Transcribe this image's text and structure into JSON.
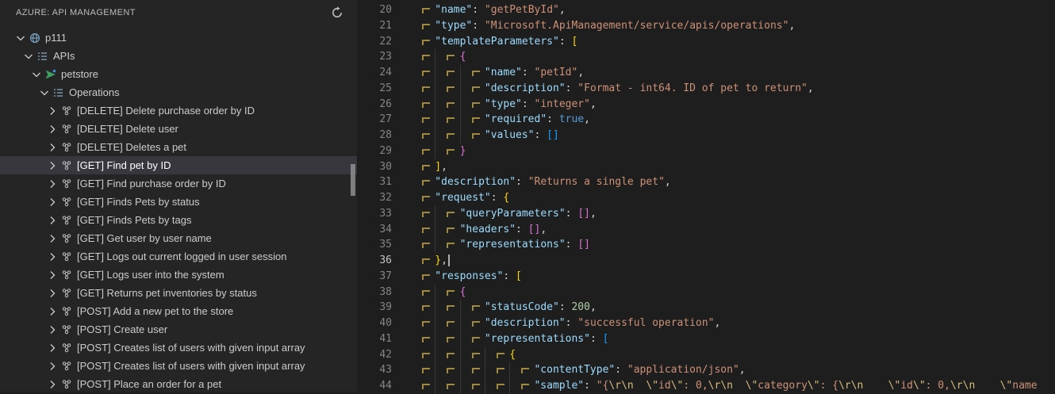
{
  "colors": {
    "bg": "#1e1e1e",
    "sidebar": "#252526",
    "selection": "#37373d",
    "text": "#cccccc",
    "title": "#bcbcbc",
    "linenum": "#858585",
    "linenum_active": "#c6c6c6",
    "key": "#9cdcfe",
    "str": "#ce9178",
    "num": "#b5cea8",
    "bool": "#569cd6",
    "punct": "#d4d4d4",
    "esc": "#d7ba7d",
    "b1": "#ffd700",
    "b2": "#da70d6",
    "b3": "#179fff",
    "indent_mark": "#a08a42",
    "guide": "#373737",
    "caret": "#aeafad",
    "scrollbar": "#9c9c9c"
  },
  "sidebar": {
    "title": "AZURE: API MANAGEMENT",
    "refresh_tooltip": "Refresh",
    "tree": [
      {
        "label": "p111",
        "level": 0,
        "icon": "apim-service",
        "expanded": true,
        "selected": false
      },
      {
        "label": "APIs",
        "level": 1,
        "icon": "list",
        "expanded": true,
        "selected": false
      },
      {
        "label": "petstore",
        "level": 2,
        "icon": "api",
        "expanded": true,
        "selected": false
      },
      {
        "label": "Operations",
        "level": 3,
        "icon": "list",
        "expanded": true,
        "selected": false
      },
      {
        "label": "[DELETE] Delete purchase order by ID",
        "level": 4,
        "icon": "operation",
        "expanded": false,
        "selected": false
      },
      {
        "label": "[DELETE] Delete user",
        "level": 4,
        "icon": "operation",
        "expanded": false,
        "selected": false
      },
      {
        "label": "[DELETE] Deletes a pet",
        "level": 4,
        "icon": "operation",
        "expanded": false,
        "selected": false
      },
      {
        "label": "[GET] Find pet by ID",
        "level": 4,
        "icon": "operation",
        "expanded": false,
        "selected": true
      },
      {
        "label": "[GET] Find purchase order by ID",
        "level": 4,
        "icon": "operation",
        "expanded": false,
        "selected": false
      },
      {
        "label": "[GET] Finds Pets by status",
        "level": 4,
        "icon": "operation",
        "expanded": false,
        "selected": false
      },
      {
        "label": "[GET] Finds Pets by tags",
        "level": 4,
        "icon": "operation",
        "expanded": false,
        "selected": false
      },
      {
        "label": "[GET] Get user by user name",
        "level": 4,
        "icon": "operation",
        "expanded": false,
        "selected": false
      },
      {
        "label": "[GET] Logs out current logged in user session",
        "level": 4,
        "icon": "operation",
        "expanded": false,
        "selected": false
      },
      {
        "label": "[GET] Logs user into the system",
        "level": 4,
        "icon": "operation",
        "expanded": false,
        "selected": false
      },
      {
        "label": "[GET] Returns pet inventories by status",
        "level": 4,
        "icon": "operation",
        "expanded": false,
        "selected": false
      },
      {
        "label": "[POST] Add a new pet to the store",
        "level": 4,
        "icon": "operation",
        "expanded": false,
        "selected": false
      },
      {
        "label": "[POST] Create user",
        "level": 4,
        "icon": "operation",
        "expanded": false,
        "selected": false
      },
      {
        "label": "[POST] Creates list of users with given input array",
        "level": 4,
        "icon": "operation",
        "expanded": false,
        "selected": false
      },
      {
        "label": "[POST] Creates list of users with given input array",
        "level": 4,
        "icon": "operation",
        "expanded": false,
        "selected": false
      },
      {
        "label": "[POST] Place an order for a pet",
        "level": 4,
        "icon": "operation",
        "expanded": false,
        "selected": false
      }
    ]
  },
  "editor": {
    "language": "json",
    "cursor_line": 36,
    "lines": [
      {
        "n": 20,
        "indent": 1,
        "tokens": [
          [
            "key",
            "\"name\""
          ],
          [
            "punct",
            ": "
          ],
          [
            "str",
            "\"getPetById\""
          ],
          [
            "punct",
            ","
          ]
        ]
      },
      {
        "n": 21,
        "indent": 1,
        "tokens": [
          [
            "key",
            "\"type\""
          ],
          [
            "punct",
            ": "
          ],
          [
            "str",
            "\"Microsoft.ApiManagement/service/apis/operations\""
          ],
          [
            "punct",
            ","
          ]
        ]
      },
      {
        "n": 22,
        "indent": 1,
        "tokens": [
          [
            "key",
            "\"templateParameters\""
          ],
          [
            "punct",
            ": "
          ],
          [
            "b1",
            "["
          ]
        ]
      },
      {
        "n": 23,
        "indent": 2,
        "tokens": [
          [
            "b2",
            "{"
          ]
        ]
      },
      {
        "n": 24,
        "indent": 3,
        "tokens": [
          [
            "key",
            "\"name\""
          ],
          [
            "punct",
            ": "
          ],
          [
            "str",
            "\"petId\""
          ],
          [
            "punct",
            ","
          ]
        ]
      },
      {
        "n": 25,
        "indent": 3,
        "tokens": [
          [
            "key",
            "\"description\""
          ],
          [
            "punct",
            ": "
          ],
          [
            "str",
            "\"Format - int64. ID of pet to return\""
          ],
          [
            "punct",
            ","
          ]
        ]
      },
      {
        "n": 26,
        "indent": 3,
        "tokens": [
          [
            "key",
            "\"type\""
          ],
          [
            "punct",
            ": "
          ],
          [
            "str",
            "\"integer\""
          ],
          [
            "punct",
            ","
          ]
        ]
      },
      {
        "n": 27,
        "indent": 3,
        "tokens": [
          [
            "key",
            "\"required\""
          ],
          [
            "punct",
            ": "
          ],
          [
            "bool",
            "true"
          ],
          [
            "punct",
            ","
          ]
        ]
      },
      {
        "n": 28,
        "indent": 3,
        "tokens": [
          [
            "key",
            "\"values\""
          ],
          [
            "punct",
            ": "
          ],
          [
            "b3",
            "[]"
          ]
        ]
      },
      {
        "n": 29,
        "indent": 2,
        "tokens": [
          [
            "b2",
            "}"
          ]
        ]
      },
      {
        "n": 30,
        "indent": 1,
        "tokens": [
          [
            "b1",
            "]"
          ],
          [
            "punct",
            ","
          ]
        ]
      },
      {
        "n": 31,
        "indent": 1,
        "tokens": [
          [
            "key",
            "\"description\""
          ],
          [
            "punct",
            ": "
          ],
          [
            "str",
            "\"Returns a single pet\""
          ],
          [
            "punct",
            ","
          ]
        ]
      },
      {
        "n": 32,
        "indent": 1,
        "tokens": [
          [
            "key",
            "\"request\""
          ],
          [
            "punct",
            ": "
          ],
          [
            "b1",
            "{"
          ]
        ]
      },
      {
        "n": 33,
        "indent": 2,
        "tokens": [
          [
            "key",
            "\"queryParameters\""
          ],
          [
            "punct",
            ": "
          ],
          [
            "b2",
            "[]"
          ],
          [
            "punct",
            ","
          ]
        ]
      },
      {
        "n": 34,
        "indent": 2,
        "tokens": [
          [
            "key",
            "\"headers\""
          ],
          [
            "punct",
            ": "
          ],
          [
            "b2",
            "[]"
          ],
          [
            "punct",
            ","
          ]
        ]
      },
      {
        "n": 35,
        "indent": 2,
        "tokens": [
          [
            "key",
            "\"representations\""
          ],
          [
            "punct",
            ": "
          ],
          [
            "b2",
            "[]"
          ]
        ]
      },
      {
        "n": 36,
        "indent": 1,
        "tokens": [
          [
            "b1",
            "}"
          ],
          [
            "punct",
            ","
          ]
        ]
      },
      {
        "n": 37,
        "indent": 1,
        "tokens": [
          [
            "key",
            "\"responses\""
          ],
          [
            "punct",
            ": "
          ],
          [
            "b1",
            "["
          ]
        ]
      },
      {
        "n": 38,
        "indent": 2,
        "tokens": [
          [
            "b2",
            "{"
          ]
        ]
      },
      {
        "n": 39,
        "indent": 3,
        "tokens": [
          [
            "key",
            "\"statusCode\""
          ],
          [
            "punct",
            ": "
          ],
          [
            "num",
            "200"
          ],
          [
            "punct",
            ","
          ]
        ]
      },
      {
        "n": 40,
        "indent": 3,
        "tokens": [
          [
            "key",
            "\"description\""
          ],
          [
            "punct",
            ": "
          ],
          [
            "str",
            "\"successful operation\""
          ],
          [
            "punct",
            ","
          ]
        ]
      },
      {
        "n": 41,
        "indent": 3,
        "tokens": [
          [
            "key",
            "\"representations\""
          ],
          [
            "punct",
            ": "
          ],
          [
            "b3",
            "["
          ]
        ]
      },
      {
        "n": 42,
        "indent": 4,
        "tokens": [
          [
            "b1",
            "{"
          ]
        ]
      },
      {
        "n": 43,
        "indent": 5,
        "tokens": [
          [
            "key",
            "\"contentType\""
          ],
          [
            "punct",
            ": "
          ],
          [
            "str",
            "\"application/json\""
          ],
          [
            "punct",
            ","
          ]
        ]
      },
      {
        "n": 44,
        "indent": 5,
        "tokens": [
          [
            "key",
            "\"sample\""
          ],
          [
            "punct",
            ": "
          ],
          [
            "str",
            "\"{"
          ],
          [
            "esc",
            "\\r\\n"
          ],
          [
            "str",
            "  "
          ],
          [
            "esc",
            "\\\""
          ],
          [
            "str",
            "id"
          ],
          [
            "esc",
            "\\\""
          ],
          [
            "str",
            ": 0,"
          ],
          [
            "esc",
            "\\r\\n"
          ],
          [
            "str",
            "  "
          ],
          [
            "esc",
            "\\\""
          ],
          [
            "str",
            "category"
          ],
          [
            "esc",
            "\\\""
          ],
          [
            "str",
            ": {"
          ],
          [
            "esc",
            "\\r\\n"
          ],
          [
            "str",
            "    "
          ],
          [
            "esc",
            "\\\""
          ],
          [
            "str",
            "id"
          ],
          [
            "esc",
            "\\\""
          ],
          [
            "str",
            ": 0,"
          ],
          [
            "esc",
            "\\r\\n"
          ],
          [
            "str",
            "    "
          ],
          [
            "esc",
            "\\\""
          ],
          [
            "str",
            "name"
          ]
        ]
      }
    ]
  }
}
